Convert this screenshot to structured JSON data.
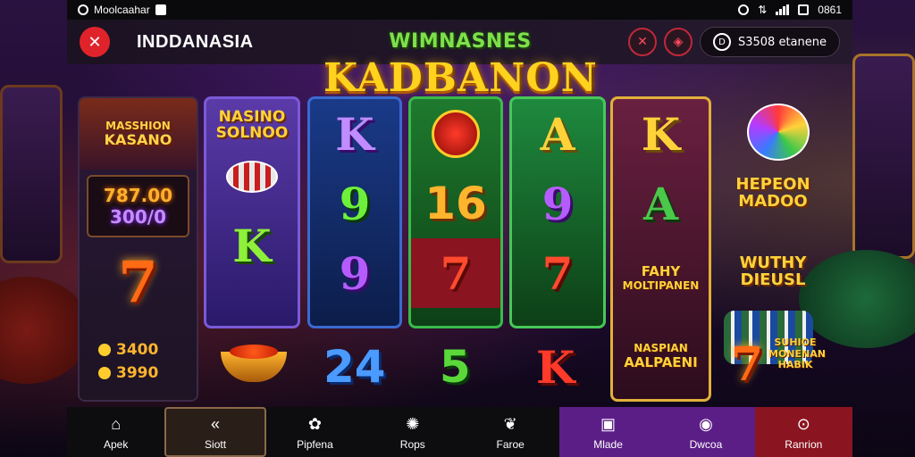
{
  "status_bar": {
    "app_label": "Moolcaahar",
    "time": "0861"
  },
  "header": {
    "brand": "INDDANASIA",
    "balance_prefix": "D",
    "balance_text": "S3508 etanene"
  },
  "title": {
    "line1": "WIMNASNES",
    "line2": "KADBANON"
  },
  "left_panel": {
    "promo_line1": "MASSHION",
    "promo_line2": "KASANO",
    "jackpot_top": "787.00",
    "jackpot_bottom": "300/0",
    "symbol": "7",
    "coins": [
      "3400",
      "3990"
    ]
  },
  "reels": {
    "r1": {
      "title_line1": "NASINO",
      "title_line2": "SOLNOO",
      "symbol": "K"
    },
    "r2": {
      "s1": "K",
      "s2": "9",
      "s3": "9"
    },
    "r3": {
      "s2": "16",
      "s3": "7"
    },
    "r4": {
      "s1": "A",
      "s2": "9",
      "s3": "7"
    },
    "r5": {
      "s1": "K",
      "s2": "A",
      "box1_line1": "FAHY",
      "box1_line2": "MOLTIPANEN",
      "box2_line1": "NASPIAN",
      "box2_line2": "AALPAENI"
    }
  },
  "bottom_row": {
    "n1": "24",
    "n2": "5",
    "n3": "K"
  },
  "right_panel": {
    "text1_line1": "HEPEON",
    "text1_line2": "MADOO",
    "text2_line1": "WUTHY",
    "text2_line2": "DIEUSL",
    "symbol": "7",
    "small_text": "SUHIOE MONENAN HABIK"
  },
  "nav": {
    "items": [
      {
        "label": "Apek",
        "icon": "home-icon"
      },
      {
        "label": "Siott",
        "icon": "back-arrow-icon"
      },
      {
        "label": "Pipfena",
        "icon": "gift-icon"
      },
      {
        "label": "Rops",
        "icon": "gear-icon"
      },
      {
        "label": "Faroe",
        "icon": "leaf-icon"
      },
      {
        "label": "Mlade",
        "icon": "bag-icon"
      },
      {
        "label": "Dwcoa",
        "icon": "check-circle-icon"
      },
      {
        "label": "Ranrion",
        "icon": "search-icon"
      }
    ]
  },
  "colors": {
    "accent": "#e0232b",
    "gold": "#ffd21e",
    "nav_purple": "#5b1e86",
    "nav_red": "#8a1420"
  }
}
